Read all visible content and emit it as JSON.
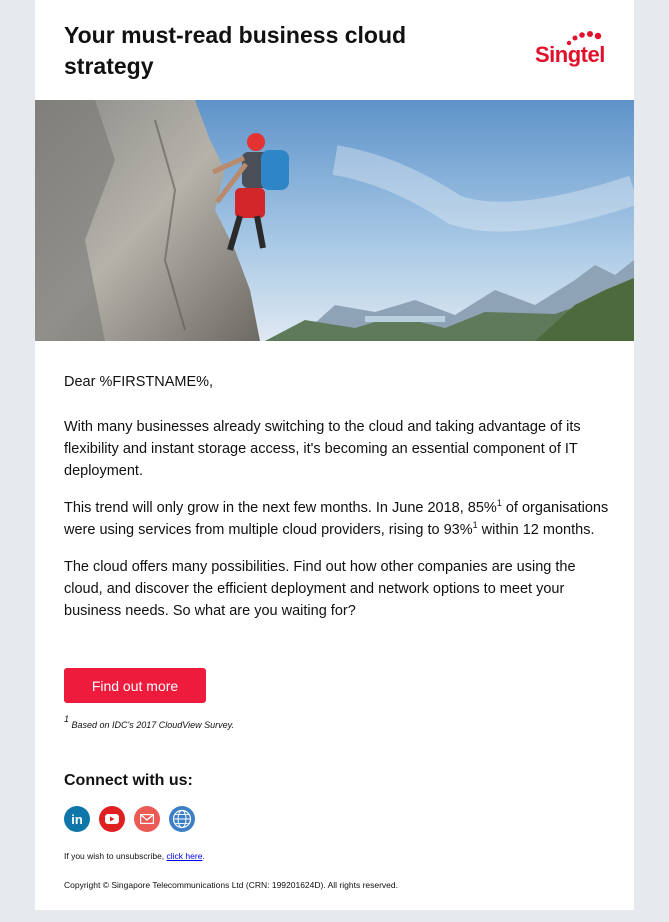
{
  "header": {
    "title": "Your must-read business cloud strategy",
    "logo_text": "Singtel"
  },
  "hero": {
    "alt": "rock-climber-on-cliff-with-mountain-view"
  },
  "body": {
    "greeting": "Dear %FIRSTNAME%,",
    "p1": "With many businesses already switching to the cloud and taking advantage of its flexibility and instant storage access, it's becoming an essential component of IT deployment.",
    "p2_a": "This trend will only grow in the next few months. In June 2018, 85%",
    "p2_sup1": "1",
    "p2_b": " of organisations were using services from multiple cloud providers, rising to 93%",
    "p2_sup2": "1",
    "p2_c": " within 12 months.",
    "p3": "The cloud offers many possibilities. Find out how other companies are using the cloud, and discover the efficient deployment and network options to meet your business needs. So what are you waiting for?"
  },
  "cta": {
    "label": "Find out more"
  },
  "footnote": {
    "sup": "1",
    "text": " Based on IDC's 2017 CloudView Survey."
  },
  "footer": {
    "connect_label": "Connect with us:",
    "socials": [
      {
        "icon": "linkedin-icon",
        "glyph": "in",
        "color": "#0e76a8"
      },
      {
        "icon": "youtube-icon",
        "color": "#e02020"
      },
      {
        "icon": "email-icon",
        "color": "#ec5a55"
      },
      {
        "icon": "globe-icon",
        "color": "#3d7fc4"
      }
    ],
    "unsubscribe_text": "If you wish to unsubscribe, ",
    "unsubscribe_link": "click here",
    "unsubscribe_end": ".",
    "copyright": "Copyright © Singapore Telecommunications Ltd (CRN: 199201624D). All rights reserved."
  },
  "colors": {
    "brand_red": "#e0112b",
    "button_red": "#ee1b3d",
    "page_bg": "#e6e9ed"
  }
}
